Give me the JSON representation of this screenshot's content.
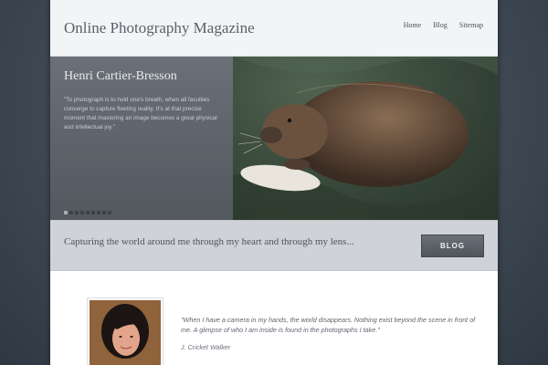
{
  "site": {
    "title": "Online Photography Magazine"
  },
  "nav": {
    "items": [
      "Home",
      "Blog",
      "Sitemap"
    ]
  },
  "slider": {
    "title": "Henri Cartier-Bresson",
    "quote": "\"To photograph is to hold one's breath, when all faculties converge to capture fleeting reality. It's at that precise moment that mastering an image becomes a great physical and intellectual joy.\"",
    "slide_count": 9,
    "active_index": 0
  },
  "tagline_bar": {
    "tagline": "Capturing the world around me through my heart and through my lens...",
    "button_label": "BLOG"
  },
  "intro": {
    "quote": "\"When I have a camera in my hands, the world disappears. Nothing exist beyond the scene in front of me. A glimpse of who I am inside is found in the photographs I take.\"",
    "author": "J. Cricket Walker"
  }
}
